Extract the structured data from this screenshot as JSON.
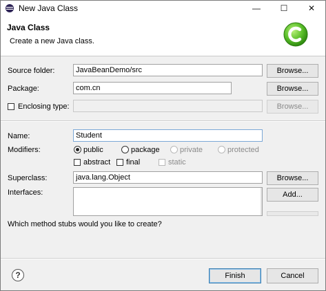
{
  "window": {
    "title": "New Java Class",
    "minimize": "—",
    "maximize": "☐",
    "close": "✕"
  },
  "header": {
    "title": "Java Class",
    "description": "Create a new Java class."
  },
  "source_folder": {
    "label": "Source folder:",
    "value": "JavaBeanDemo/src",
    "browse": "Browse..."
  },
  "package": {
    "label": "Package:",
    "value": "com.cn",
    "browse": "Browse..."
  },
  "enclosing_type": {
    "label": "Enclosing type:",
    "value": "",
    "browse": "Browse..."
  },
  "name": {
    "label": "Name:",
    "value": "Student"
  },
  "modifiers": {
    "label": "Modifiers:",
    "public": "public",
    "package": "package",
    "private": "private",
    "protected": "protected",
    "abstract": "abstract",
    "final": "final",
    "static": "static"
  },
  "superclass": {
    "label": "Superclass:",
    "value": "java.lang.Object",
    "browse": "Browse..."
  },
  "interfaces": {
    "label": "Interfaces:",
    "add": "Add..."
  },
  "stubs": {
    "question": "Which method stubs would you like to create?"
  },
  "footer": {
    "help": "?",
    "finish": "Finish",
    "cancel": "Cancel"
  },
  "colors": {
    "logo_green": "#5bbf2a",
    "default_button_border": "#3c7fb1"
  }
}
